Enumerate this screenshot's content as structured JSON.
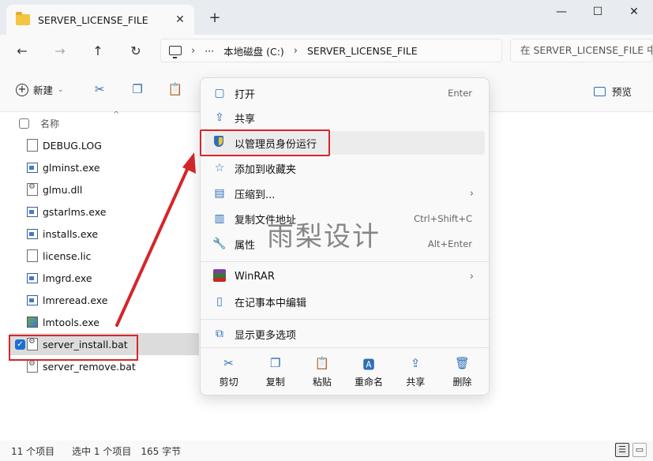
{
  "window": {
    "tab_title": "SERVER_LICENSE_FILE",
    "tab_close": "✕",
    "new_tab": "+",
    "minimize": "—",
    "maximize": "☐",
    "close": "✕"
  },
  "nav": {
    "back": "←",
    "forward": "→",
    "up": "↑",
    "refresh": "↻",
    "ellipsis": "···",
    "breadcrumbs": [
      "本地磁盘 (C:)",
      "SERVER_LICENSE_FILE"
    ],
    "separator": "›",
    "search_placeholder": "在 SERVER_LICENSE_FILE 中"
  },
  "commandbar": {
    "new_label": "新建",
    "preview_label": "预览"
  },
  "filelist": {
    "column_name": "名称",
    "files": [
      {
        "name": "DEBUG.LOG",
        "kind": "doc"
      },
      {
        "name": "glminst.exe",
        "kind": "exe"
      },
      {
        "name": "glmu.dll",
        "kind": "bat"
      },
      {
        "name": "gstarlms.exe",
        "kind": "exe"
      },
      {
        "name": "installs.exe",
        "kind": "exe"
      },
      {
        "name": "license.lic",
        "kind": "doc"
      },
      {
        "name": "lmgrd.exe",
        "kind": "exe"
      },
      {
        "name": "lmreread.exe",
        "kind": "exe"
      },
      {
        "name": "lmtools.exe",
        "kind": "tool"
      },
      {
        "name": "server_install.bat",
        "kind": "bat",
        "selected": true
      },
      {
        "name": "server_remove.bat",
        "kind": "bat"
      }
    ]
  },
  "context_menu": {
    "items": [
      {
        "label": "打开",
        "shortcut": "Enter",
        "icon": "open-icon"
      },
      {
        "label": "共享",
        "shortcut": "",
        "icon": "share-icon"
      },
      {
        "label": "以管理员身份运行",
        "shortcut": "",
        "icon": "shield-icon"
      },
      {
        "label": "添加到收藏夹",
        "shortcut": "",
        "icon": "star-icon"
      },
      {
        "label": "压缩到...",
        "shortcut": "",
        "icon": "zip-icon"
      },
      {
        "label": "复制文件地址",
        "shortcut": "Ctrl+Shift+C",
        "icon": "copy-path-icon"
      },
      {
        "label": "属性",
        "shortcut": "Alt+Enter",
        "icon": "wrench-icon"
      },
      {
        "label": "WinRAR",
        "shortcut": "",
        "icon": "winrar-icon"
      },
      {
        "label": "在记事本中编辑",
        "shortcut": "",
        "icon": "notepad-icon"
      },
      {
        "label": "显示更多选项",
        "shortcut": "",
        "icon": "more-options-icon"
      }
    ],
    "tools": [
      {
        "label": "剪切",
        "icon": "cut-icon"
      },
      {
        "label": "复制",
        "icon": "copy-icon"
      },
      {
        "label": "粘贴",
        "icon": "paste-icon"
      },
      {
        "label": "重命名",
        "icon": "rename-icon"
      },
      {
        "label": "共享",
        "icon": "share-icon"
      },
      {
        "label": "删除",
        "icon": "delete-icon"
      }
    ]
  },
  "watermark": "雨梨设计",
  "status": {
    "item_count": "11 个项目",
    "selection": "选中 1 个项目",
    "size": "165 字节"
  },
  "colors": {
    "accent": "#2d6fb7",
    "highlight_red": "#d5262a"
  }
}
